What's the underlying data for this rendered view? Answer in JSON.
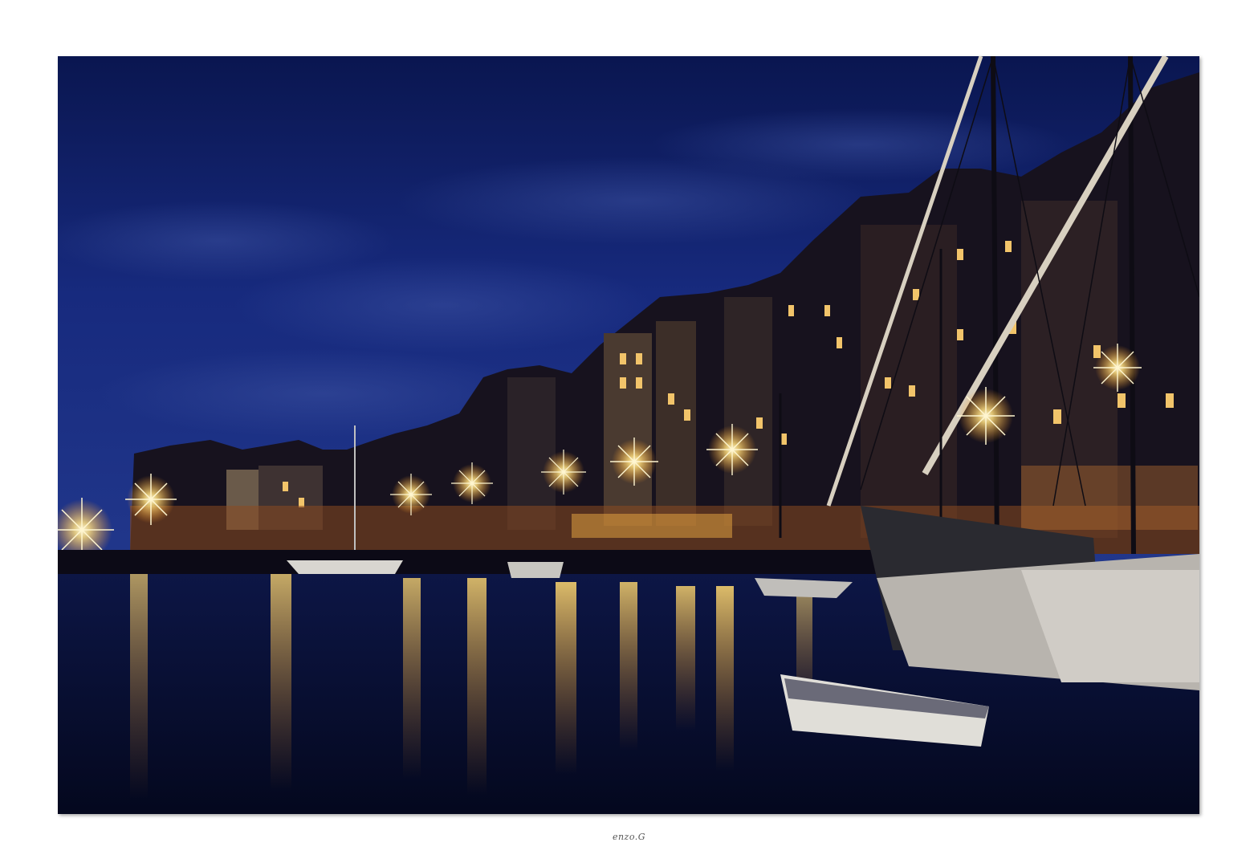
{
  "photo": {
    "subject": "harbor-at-night",
    "colors": {
      "sky_top": "#0b1a5a",
      "sky_mid": "#1b2f86",
      "sky_low": "#2b3f8f",
      "buildings": "#1a1522",
      "water": "#070c2c",
      "lamp": "#ffe9a8",
      "reflection": "#e0a030"
    }
  },
  "signature": {
    "text": "enzo.G"
  }
}
